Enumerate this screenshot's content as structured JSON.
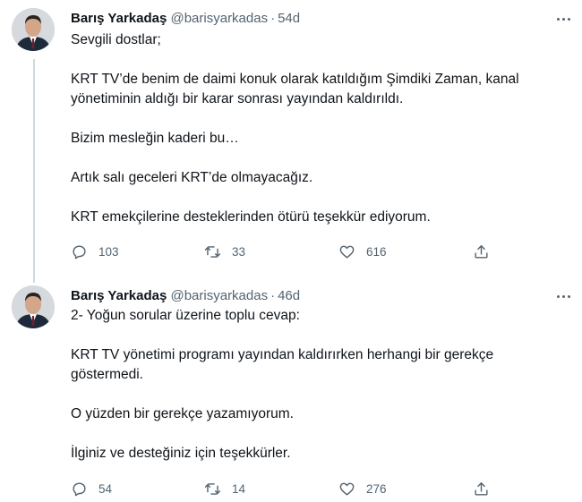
{
  "tweets": [
    {
      "author": {
        "name": "Barış Yarkadaş",
        "handle": "@barisyarkadas"
      },
      "separator": "·",
      "time": "54d",
      "paragraphs": [
        "Sevgili dostlar;",
        "KRT TV’de benim de daimi konuk olarak katıldığım Şimdiki Zaman, kanal yönetiminin aldığı bir karar sonrası yayından kaldırıldı.",
        "Bizim mesleğin kaderi bu…",
        "Artık salı geceleri KRT’de olmayacağız.",
        "KRT emekçilerine desteklerinden ötürü teşekkür ediyorum."
      ],
      "stats": {
        "replies": "103",
        "retweets": "33",
        "likes": "616"
      }
    },
    {
      "author": {
        "name": "Barış Yarkadaş",
        "handle": "@barisyarkadas"
      },
      "separator": "·",
      "time": "46d",
      "paragraphs": [
        "2- Yoğun sorular üzerine toplu cevap:",
        "KRT TV yönetimi programı yayından kaldırırken herhangi bir gerekçe göstermedi.",
        "O yüzden bir gerekçe yazamıyorum.",
        "İlginiz ve desteğiniz için teşekkürler."
      ],
      "stats": {
        "replies": "54",
        "retweets": "14",
        "likes": "276"
      }
    }
  ],
  "icons": {
    "reply": "reply-icon",
    "retweet": "retweet-icon",
    "like": "heart-icon",
    "share": "share-icon",
    "more": "more-options-icon"
  },
  "colors": {
    "text": "#0f1419",
    "secondary": "#536471",
    "thread_line": "#cfd9de"
  }
}
